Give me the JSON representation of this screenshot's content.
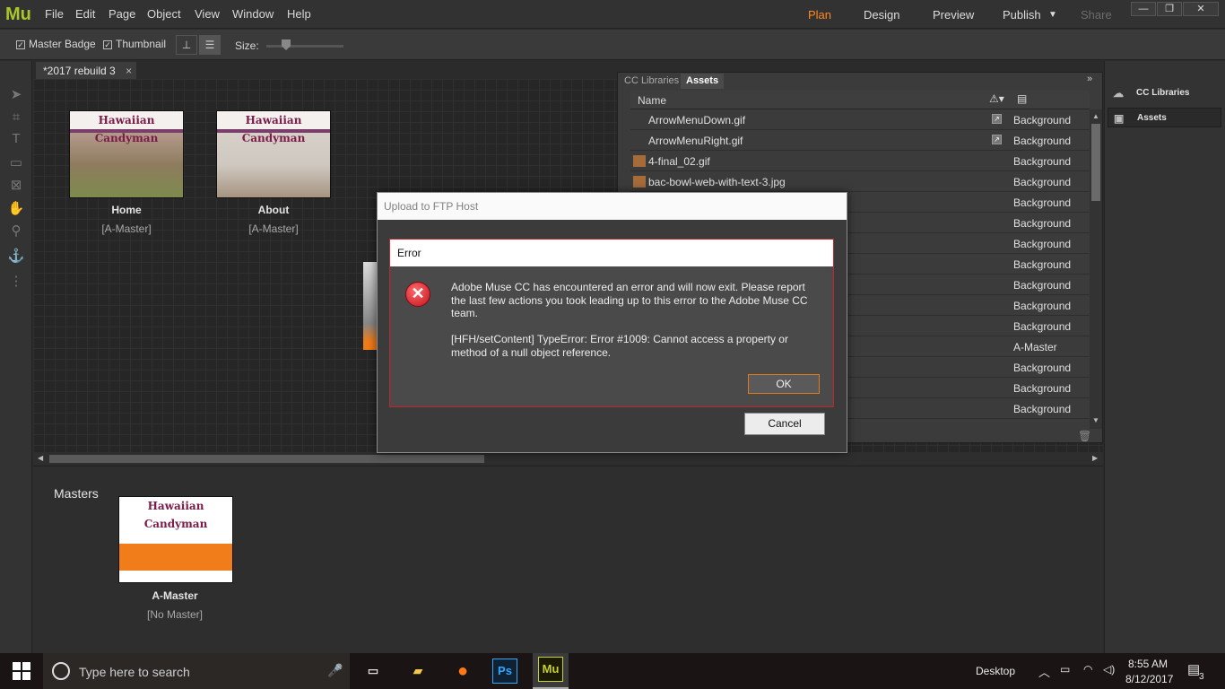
{
  "app": {
    "logo": "Mu",
    "menu": [
      "File",
      "Edit",
      "Page",
      "Object",
      "View",
      "Window",
      "Help"
    ],
    "modes": [
      "Plan",
      "Design",
      "Preview",
      "Publish",
      "Share"
    ],
    "accent_color": "#ff8a1e"
  },
  "toolbar": {
    "master_badge_label": "Master Badge",
    "thumbnail_label": "Thumbnail",
    "size_label": "Size:"
  },
  "document": {
    "tab_title": "*2017 rebuild 3",
    "close_glyph": "×"
  },
  "pages": [
    {
      "thumb_title": "Hawaiian Candyman",
      "name": "Home",
      "master": "[A-Master]"
    },
    {
      "thumb_title": "Hawaiian Candyman",
      "name": "About",
      "master": "[A-Master]"
    }
  ],
  "masters": {
    "title": "Masters",
    "items": [
      {
        "thumb_title": "Hawaiian Candyman",
        "name": "A-Master",
        "master": "[No Master]"
      }
    ]
  },
  "panel": {
    "tabs": [
      "CC Libraries",
      "Assets"
    ],
    "column_name": "Name",
    "rows": [
      {
        "name": "ArrowMenuDown.gif",
        "page": "Background"
      },
      {
        "name": "ArrowMenuRight.gif",
        "page": "Background"
      },
      {
        "name": "4-final_02.gif",
        "page": "Background"
      },
      {
        "name": "bac-bowl-web-with-text-3.jpg",
        "page": "Background"
      },
      {
        "name": "",
        "page": "Background"
      },
      {
        "name": "",
        "page": "Background"
      },
      {
        "name": "",
        "page": "Background"
      },
      {
        "name": "",
        "page": "Background"
      },
      {
        "name": "",
        "page": "Background"
      },
      {
        "name": "",
        "page": "Background"
      },
      {
        "name": "",
        "page": "Background"
      },
      {
        "name": "",
        "page": "A-Master"
      },
      {
        "name": "",
        "page": "Background"
      },
      {
        "name": "",
        "page": "Background"
      },
      {
        "name": "",
        "page": "Background"
      }
    ]
  },
  "right_sidebar": {
    "items": [
      "CC Libraries",
      "Assets"
    ]
  },
  "ftp_dialog": {
    "title": "Upload to FTP Host",
    "cancel_label": "Cancel"
  },
  "error_dialog": {
    "title": "Error",
    "message": "Adobe Muse CC has encountered an error and will now exit. Please report the last few actions you took leading up to this error to the Adobe Muse CC team.",
    "detail": "[HFH/setContent] TypeError: Error #1009: Cannot access a property or method of a null object reference.",
    "ok_label": "OK",
    "border_color": "#c8232c"
  },
  "taskbar": {
    "search_placeholder": "Type here to search",
    "desktop_label": "Desktop",
    "time": "8:55 AM",
    "date": "8/12/2017",
    "notification_count": "3"
  }
}
